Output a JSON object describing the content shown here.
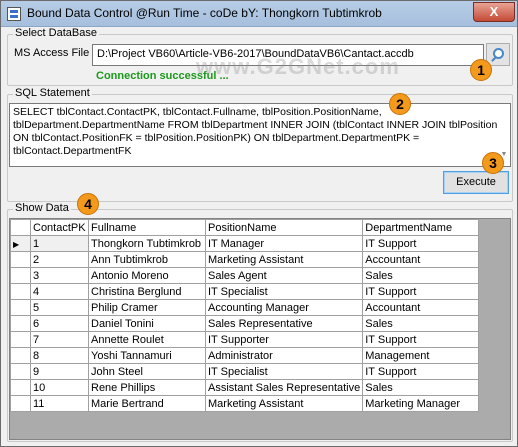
{
  "window": {
    "title": "Bound Data Control @Run Time - coDe bY: Thongkorn Tubtimkrob",
    "close_glyph": "X"
  },
  "database_group": {
    "label": "Select DataBase",
    "ms_access_label": "MS Access File",
    "file_path": "D:\\Project VB60\\Article-VB6-2017\\BoundDataVB6\\Cantact.accdb",
    "status": "Connection successful ...",
    "status_color": "#1a9a1a"
  },
  "sql_group": {
    "label": "SQL Statement",
    "query": "SELECT tblContact.ContactPK, tblContact.Fullname, tblPosition.PositionName, tblDepartment.DepartmentName FROM tblDepartment INNER JOIN (tblContact INNER JOIN tblPosition ON tblContact.PositionFK = tblPosition.PositionPK) ON tblDepartment.DepartmentPK = tblContact.DepartmentFK",
    "execute_label": "Execute"
  },
  "data_group": {
    "label": "Show Data",
    "columns": [
      "ContactPK",
      "Fullname",
      "PositionName",
      "DepartmentName"
    ],
    "selected_row": 0,
    "rows": [
      [
        "1",
        "Thongkorn Tubtimkrob",
        "IT Manager",
        "IT Support"
      ],
      [
        "2",
        "Ann Tubtimkrob",
        "Marketing Assistant",
        "Accountant"
      ],
      [
        "3",
        "Antonio Moreno",
        "Sales Agent",
        "Sales"
      ],
      [
        "4",
        "Christina Berglund",
        "IT Specialist",
        "IT Support"
      ],
      [
        "5",
        "Philip Cramer",
        "Accounting Manager",
        "Accountant"
      ],
      [
        "6",
        "Daniel Tonini",
        "Sales Representative",
        "Sales"
      ],
      [
        "7",
        "Annette Roulet",
        "IT Supporter",
        "IT Support"
      ],
      [
        "8",
        "Yoshi Tannamuri",
        "Administrator",
        "Management"
      ],
      [
        "9",
        "John Steel",
        "IT Specialist",
        "IT Support"
      ],
      [
        "10",
        "Rene Phillips",
        "Assistant Sales Representative",
        "Sales"
      ],
      [
        "11",
        "Marie Bertrand",
        "Marketing Assistant",
        "Marketing Manager"
      ]
    ]
  },
  "watermark": "www.G2GNet.com",
  "annotations": [
    "1",
    "2",
    "3",
    "4"
  ],
  "colors": {
    "badge": "#f39a1d",
    "title_bar": "#b7cde6",
    "close_button": "#c44a34"
  }
}
